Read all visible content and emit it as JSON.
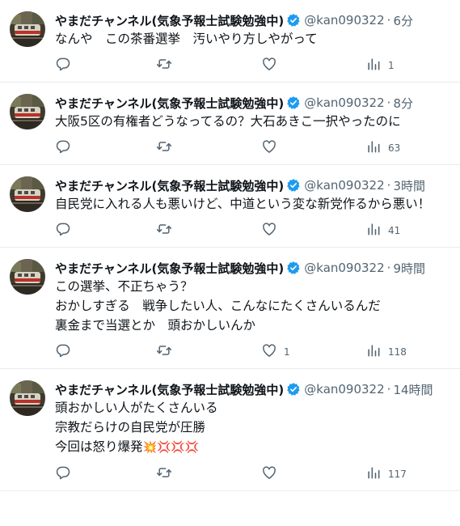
{
  "author": {
    "name": "やまだチャンネル(気象予報士試験勉強中)",
    "handle": "@kan090322",
    "verified": true,
    "verified_color": "#1d9bf0"
  },
  "colors": {
    "text": "#0f1419",
    "muted": "#536471",
    "divider": "#e8ecef"
  },
  "icons": [
    "reply-icon",
    "retweet-icon",
    "like-icon",
    "views-icon",
    "verified-badge-icon"
  ],
  "tweets": [
    {
      "time": "6分",
      "lines": [
        "なんや　この茶番選挙　汚いやり方しやがって"
      ],
      "likes": "",
      "views": "1"
    },
    {
      "time": "8分",
      "lines": [
        "大阪5区の有権者どうなってるの？大石あきこ一択やったのに"
      ],
      "likes": "",
      "views": "63"
    },
    {
      "time": "3時間",
      "lines": [
        "自民党に入れる人も悪いけど、中道という変な新党作るから悪い！"
      ],
      "likes": "",
      "views": "41"
    },
    {
      "time": "9時間",
      "lines": [
        "この選挙、不正ちゃう？",
        "おかしすぎる　戦争したい人、こんなにたくさんいるんだ",
        "裏金まで当選とか　頭おかしいんか"
      ],
      "likes": "1",
      "views": "118"
    },
    {
      "time": "14時間",
      "lines": [
        "頭おかしい人がたくさんいる",
        "宗教だらけの自民党が圧勝",
        "今回は怒り爆発"
      ],
      "emoji": "💥💢💢💢",
      "likes": "",
      "views": "117"
    }
  ]
}
